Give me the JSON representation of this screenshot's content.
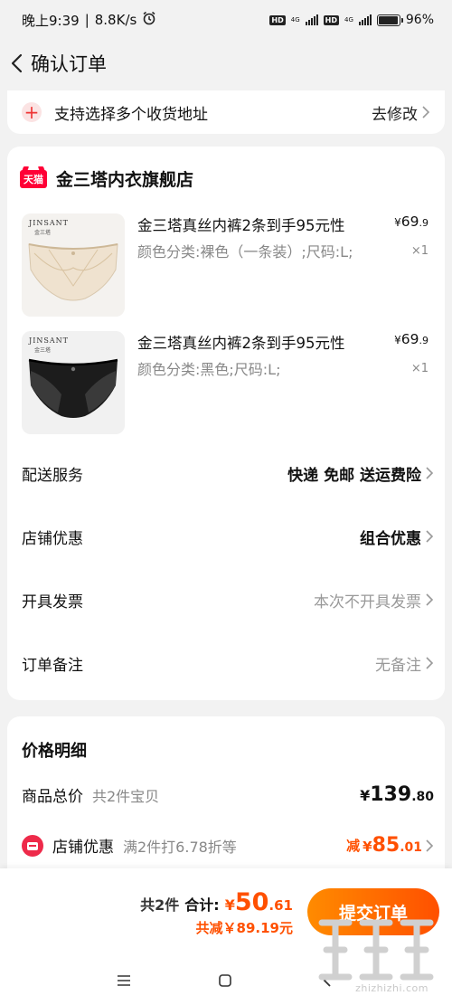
{
  "status_bar": {
    "time": "晚上9:39",
    "separator": "|",
    "net_speed": "8.8K/s",
    "network_label": "4G",
    "hd_label": "HD",
    "battery_text": "96%",
    "battery_level": 0.96
  },
  "nav": {
    "title": "确认订单"
  },
  "address_tip": {
    "text": "支持选择多个收货地址",
    "action": "去修改"
  },
  "store": {
    "badge": "天猫",
    "name": "金三塔内衣旗舰店",
    "products": [
      {
        "thumb_brand": "JINSANT",
        "thumb_brand_sub": "金三塔",
        "title": "金三塔真丝内裤2条到手95元性",
        "spec": "颜色分类:裸色（一条装）;尺码:L;",
        "price_symbol": "¥",
        "price_int": "69",
        "price_dec": ".9",
        "qty": "×1",
        "color": "nude"
      },
      {
        "thumb_brand": "JINSANT",
        "thumb_brand_sub": "金三塔",
        "title": "金三塔真丝内裤2条到手95元性",
        "spec": "颜色分类:黑色;尺码:L;",
        "price_symbol": "¥",
        "price_int": "69",
        "price_dec": ".9",
        "qty": "×1",
        "color": "black"
      }
    ],
    "rows": [
      {
        "label": "配送服务",
        "value": "快递 免邮 送运费险"
      },
      {
        "label": "店铺优惠",
        "value": "组合优惠"
      },
      {
        "label": "开具发票",
        "value": "本次不开具发票"
      },
      {
        "label": "订单备注",
        "value": "无备注"
      }
    ]
  },
  "price_detail": {
    "title": "价格明细",
    "total_label": "商品总价",
    "total_sub": "共2件宝贝",
    "total_symbol": "¥",
    "total_int": "139",
    "total_dec": ".80",
    "discount_label": "店铺优惠",
    "discount_sub": "满2件打6.78折等",
    "discount_prefix": "减",
    "discount_symbol": "¥",
    "discount_int": "85",
    "discount_dec": ".01"
  },
  "bottom_bar": {
    "count": "共2件",
    "total_label": "合计:",
    "pay_symbol": "¥",
    "pay_int": "50",
    "pay_dec": ".61",
    "saved": "共减￥89.19元",
    "submit": "提交订单"
  },
  "watermark": {
    "text": "zhizhizhi.com"
  },
  "colors": {
    "accent": "#ff5000",
    "tmall_red": "#ff0036",
    "background": "#f2f2f2"
  }
}
